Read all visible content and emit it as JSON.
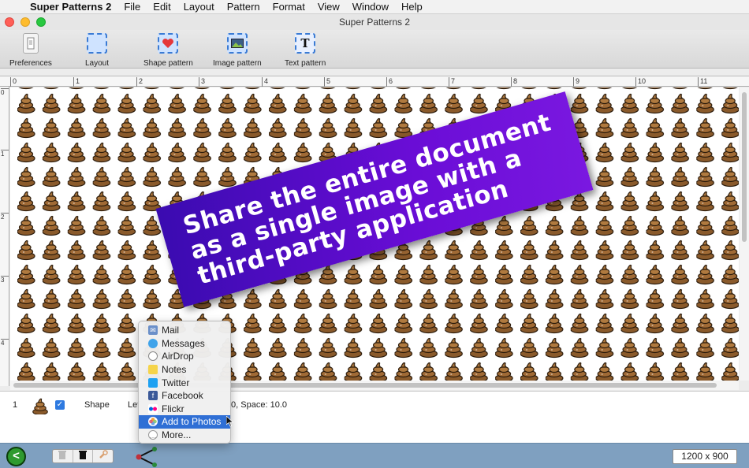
{
  "menubar": {
    "app": "Super Patterns 2",
    "items": [
      "File",
      "Edit",
      "Layout",
      "Pattern",
      "Format",
      "View",
      "Window",
      "Help"
    ]
  },
  "window": {
    "title": "Super Patterns 2"
  },
  "toolbar": {
    "items": [
      {
        "label": "Preferences",
        "icon": "preferences-icon"
      },
      {
        "label": "Layout",
        "icon": "layout-icon"
      },
      {
        "label": "Shape pattern",
        "icon": "heart-shape-icon"
      },
      {
        "label": "Image pattern",
        "icon": "image-icon"
      },
      {
        "label": "Text pattern",
        "icon": "text-T-icon"
      }
    ]
  },
  "ruler": {
    "top_labels": [
      "0",
      "1",
      "2",
      "3",
      "4",
      "5",
      "6",
      "7",
      "8",
      "9",
      "10",
      "11"
    ],
    "left_labels": [
      "0",
      "1",
      "2",
      "3",
      "4"
    ]
  },
  "banner": {
    "lines": [
      "Share the entire document",
      "as a single image with a",
      "third-party application"
    ],
    "color_start": "#3a0bb0",
    "color_end": "#7a18e0"
  },
  "layer_row": {
    "index": "1",
    "checked": true,
    "type": "Shape",
    "detail_left": "Lef",
    "detail_right": ".0, Space: 10.0"
  },
  "share_menu": {
    "items": [
      {
        "label": "Mail",
        "icon": "mail-icon",
        "color": "#6a8fc9"
      },
      {
        "label": "Messages",
        "icon": "messages-icon",
        "color": "#3fa3ea"
      },
      {
        "label": "AirDrop",
        "icon": "airdrop-icon",
        "color": "#888888"
      },
      {
        "label": "Notes",
        "icon": "notes-icon",
        "color": "#f5d44a"
      },
      {
        "label": "Twitter",
        "icon": "twitter-icon",
        "color": "#1da1f2"
      },
      {
        "label": "Facebook",
        "icon": "facebook-icon",
        "color": "#3b5998"
      },
      {
        "label": "Flickr",
        "icon": "flickr-icon",
        "color": "#ff0084"
      },
      {
        "label": "Add to Photos",
        "icon": "photos-icon",
        "color": "#e8a33c",
        "selected": true
      },
      {
        "label": "More...",
        "icon": "more-icon",
        "color": "#999999"
      }
    ]
  },
  "bottombar": {
    "back_symbol": "<",
    "size_text": "1200 x 900",
    "accent": "#7fa0c0"
  }
}
